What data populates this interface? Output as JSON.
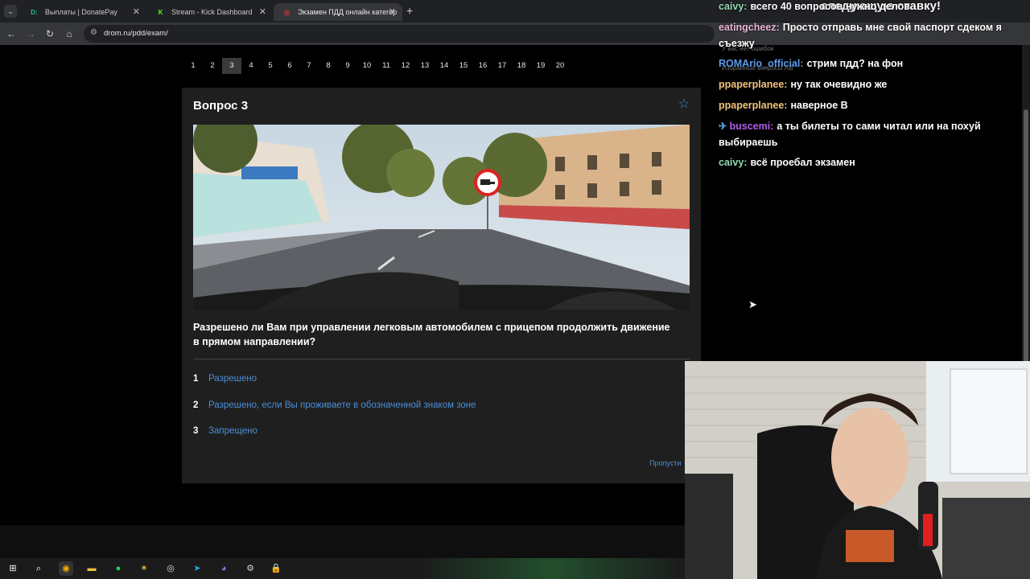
{
  "browser": {
    "tabs": [
      {
        "title": "Выплаты | DonatePay",
        "favicon": "D:",
        "color": "#19c37d"
      },
      {
        "title": "Stream - Kick Dashboard",
        "favicon": "K",
        "color": "#53fc18"
      },
      {
        "title": "Экзамен ПДД онлайн категор",
        "favicon": "◎",
        "color": "#e0342f"
      }
    ],
    "url": "drom.ru/pdd/exam/"
  },
  "pager": {
    "pages": [
      "1",
      "2",
      "3",
      "4",
      "5",
      "6",
      "7",
      "8",
      "9",
      "10",
      "11",
      "12",
      "13",
      "14",
      "15",
      "16",
      "17",
      "18",
      "19",
      "20"
    ],
    "current": "3"
  },
  "question": {
    "title": "Вопрос 3",
    "text": "Разрешено ли Вам при управлении легковым автомобилем с прицепом продолжить движение в прямом направлении?",
    "answers": [
      {
        "num": "1",
        "text": "Разрешено"
      },
      {
        "num": "2",
        "text": "Разрешено, если Вы проживаете в обозначенной знаком зоне"
      },
      {
        "num": "3",
        "text": "Запрещено"
      }
    ],
    "skip_label": "Пропусти"
  },
  "chat": {
    "banner": "следующую ставку!",
    "ghost_no_errors": "У вас нет ошибок",
    "ghost_favorites": "Избранные вопросы АВ",
    "messages": [
      {
        "user": "caivy:",
        "text": "всего 40 вопросов нужно делов",
        "color": "#8fd9b0"
      },
      {
        "user": "eatingcheez:",
        "text": "Просто отправь мне свой паспорт сдеком я съезжу",
        "color": "#e8b4d8"
      },
      {
        "user": "ROMArio_official:",
        "text": "стрим пдд? на фон",
        "color": "#5b9bea"
      },
      {
        "user": "ppaperplanee:",
        "text": "ну так очевидно же",
        "color": "#f2c37c"
      },
      {
        "user": "ppaperplanee:",
        "text": "наверное В",
        "color": "#f2c37c"
      },
      {
        "user": "buscemi:",
        "text": "а ты билеты то сами читал или на похуй выбираешь",
        "color": "#b35ce8"
      },
      {
        "user": "caivy:",
        "text": "всё проебал экзамен",
        "color": "#8fd9b0"
      }
    ]
  },
  "icons": {
    "star": "star-icon",
    "back": "back-arrow-icon",
    "forward": "forward-arrow-icon",
    "reload": "reload-icon",
    "home": "home-icon",
    "site_info": "site-info-icon"
  }
}
